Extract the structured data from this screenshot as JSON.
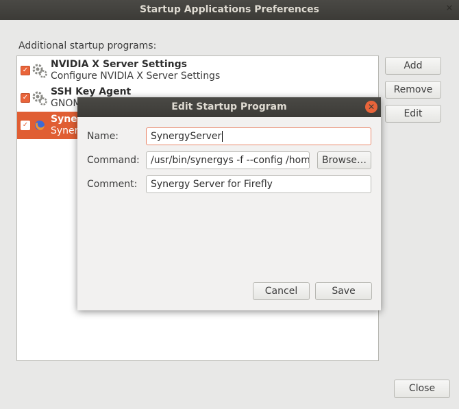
{
  "window": {
    "title": "Startup Applications Preferences"
  },
  "section_label": "Additional startup programs:",
  "programs": [
    {
      "name": "NVIDIA X Server Settings",
      "description": "Configure NVIDIA X Server Settings",
      "checked": true
    },
    {
      "name": "SSH Key Agent",
      "description": "GNOME Keyring: SSH Agent",
      "checked": true
    },
    {
      "name": "SynergyServer",
      "description": "Synergy Server for Firefly",
      "checked": true,
      "selected": true
    }
  ],
  "buttons": {
    "add": "Add",
    "remove": "Remove",
    "edit": "Edit",
    "close": "Close"
  },
  "dialog": {
    "title": "Edit Startup Program",
    "name_label": "Name:",
    "name_value": "SynergyServer",
    "command_label": "Command:",
    "command_value": "/usr/bin/synergys -f --config /home",
    "browse_label": "Browse…",
    "comment_label": "Comment:",
    "comment_value": "Synergy Server for Firefly",
    "cancel_label": "Cancel",
    "save_label": "Save"
  },
  "colors": {
    "accent": "#e9643a",
    "titlebar": "#3c3b37",
    "selection": "#e05e33"
  }
}
